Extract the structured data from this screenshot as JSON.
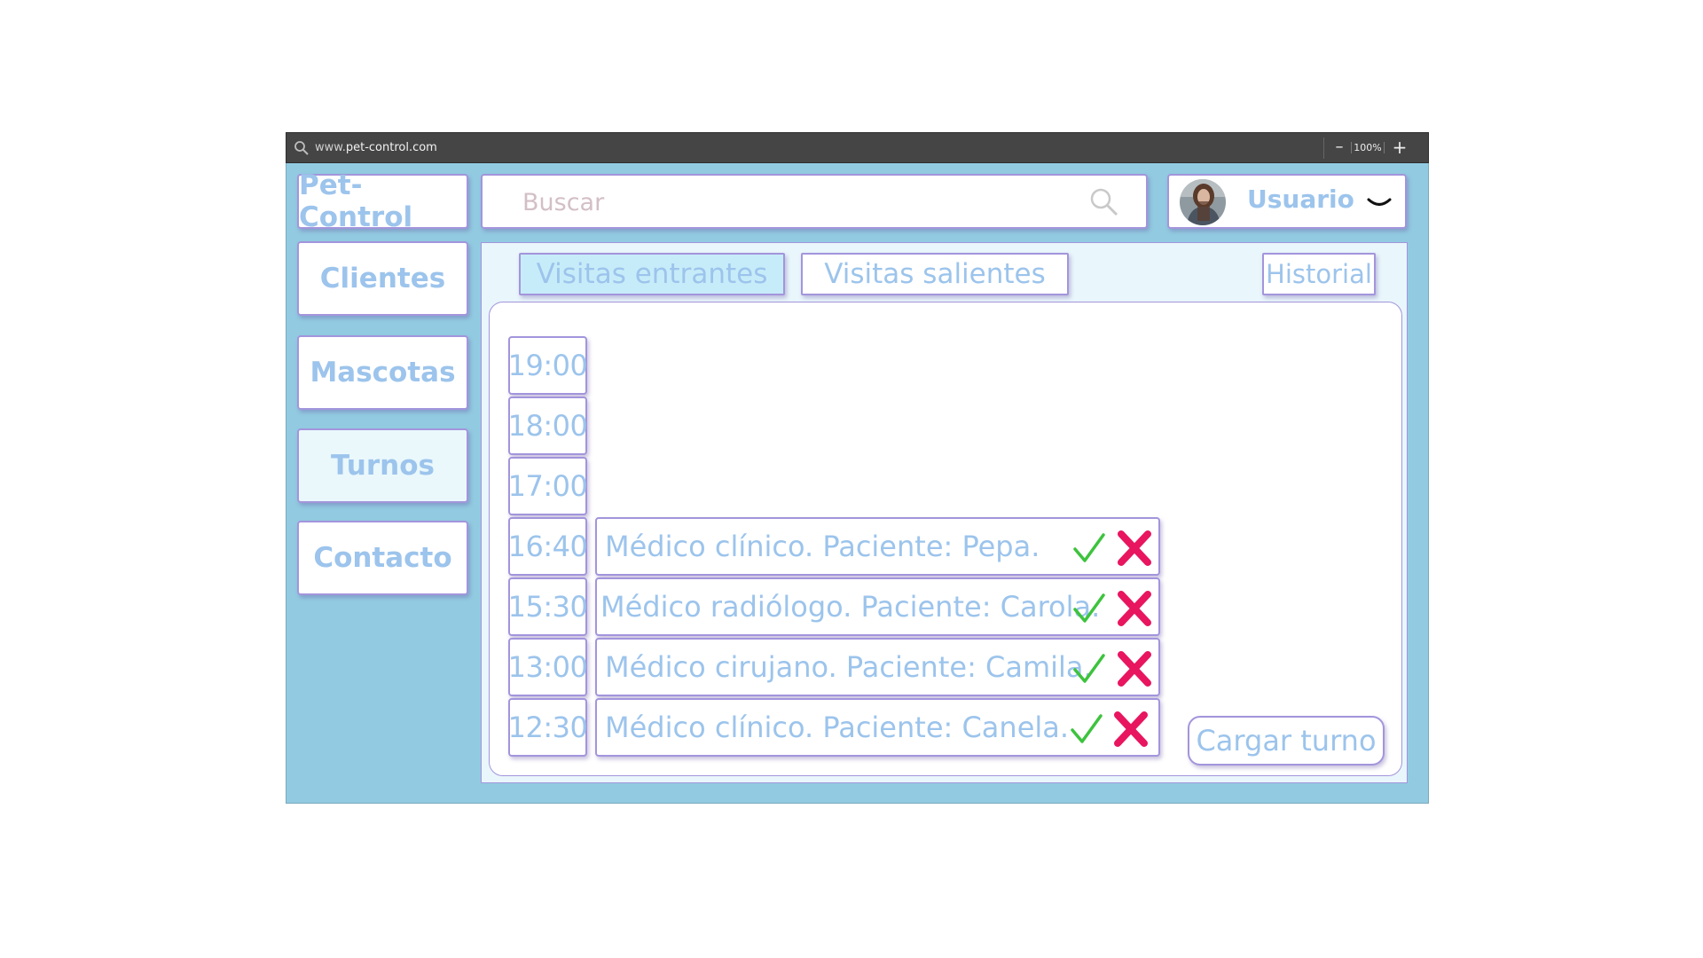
{
  "browser": {
    "url_prefix": "www.",
    "url_domain": "pet-control.com",
    "zoom_minus": "–",
    "zoom_level": "100%",
    "zoom_plus": "+"
  },
  "header": {
    "logo": "Pet-Control",
    "search_placeholder": "Buscar",
    "user_label": "Usuario"
  },
  "sidebar": {
    "items": [
      {
        "label": "Clientes"
      },
      {
        "label": "Mascotas"
      },
      {
        "label": "Turnos"
      },
      {
        "label": "Contacto"
      }
    ]
  },
  "tabs": {
    "incoming": "Visitas entrantes",
    "outgoing": "Visitas salientes",
    "history": "Historial"
  },
  "schedule": {
    "times": [
      "19:00",
      "18:00",
      "17:00",
      "16:40",
      "15:30",
      "13:00",
      "12:30"
    ],
    "appointments": [
      {
        "time": "16:40",
        "text": "Médico clínico. Paciente: Pepa."
      },
      {
        "time": "15:30",
        "text": "Médico radiólogo. Paciente: Carola."
      },
      {
        "time": "13:00",
        "text": "Médico cirujano. Paciente: Camila."
      },
      {
        "time": "12:30",
        "text": "Médico clínico. Paciente: Canela."
      }
    ],
    "load_button": "Cargar turno"
  },
  "colors": {
    "app_background": "#92cbe1",
    "text_accent": "#9cc4ec",
    "border": "#a395dc",
    "active_tab": "#c7ecf9",
    "accept": "#3dc33d",
    "reject": "#e8155f"
  },
  "icons": {
    "search": "search-icon",
    "chevron": "chevron-down-icon",
    "accept": "check-icon",
    "reject": "x-icon"
  }
}
